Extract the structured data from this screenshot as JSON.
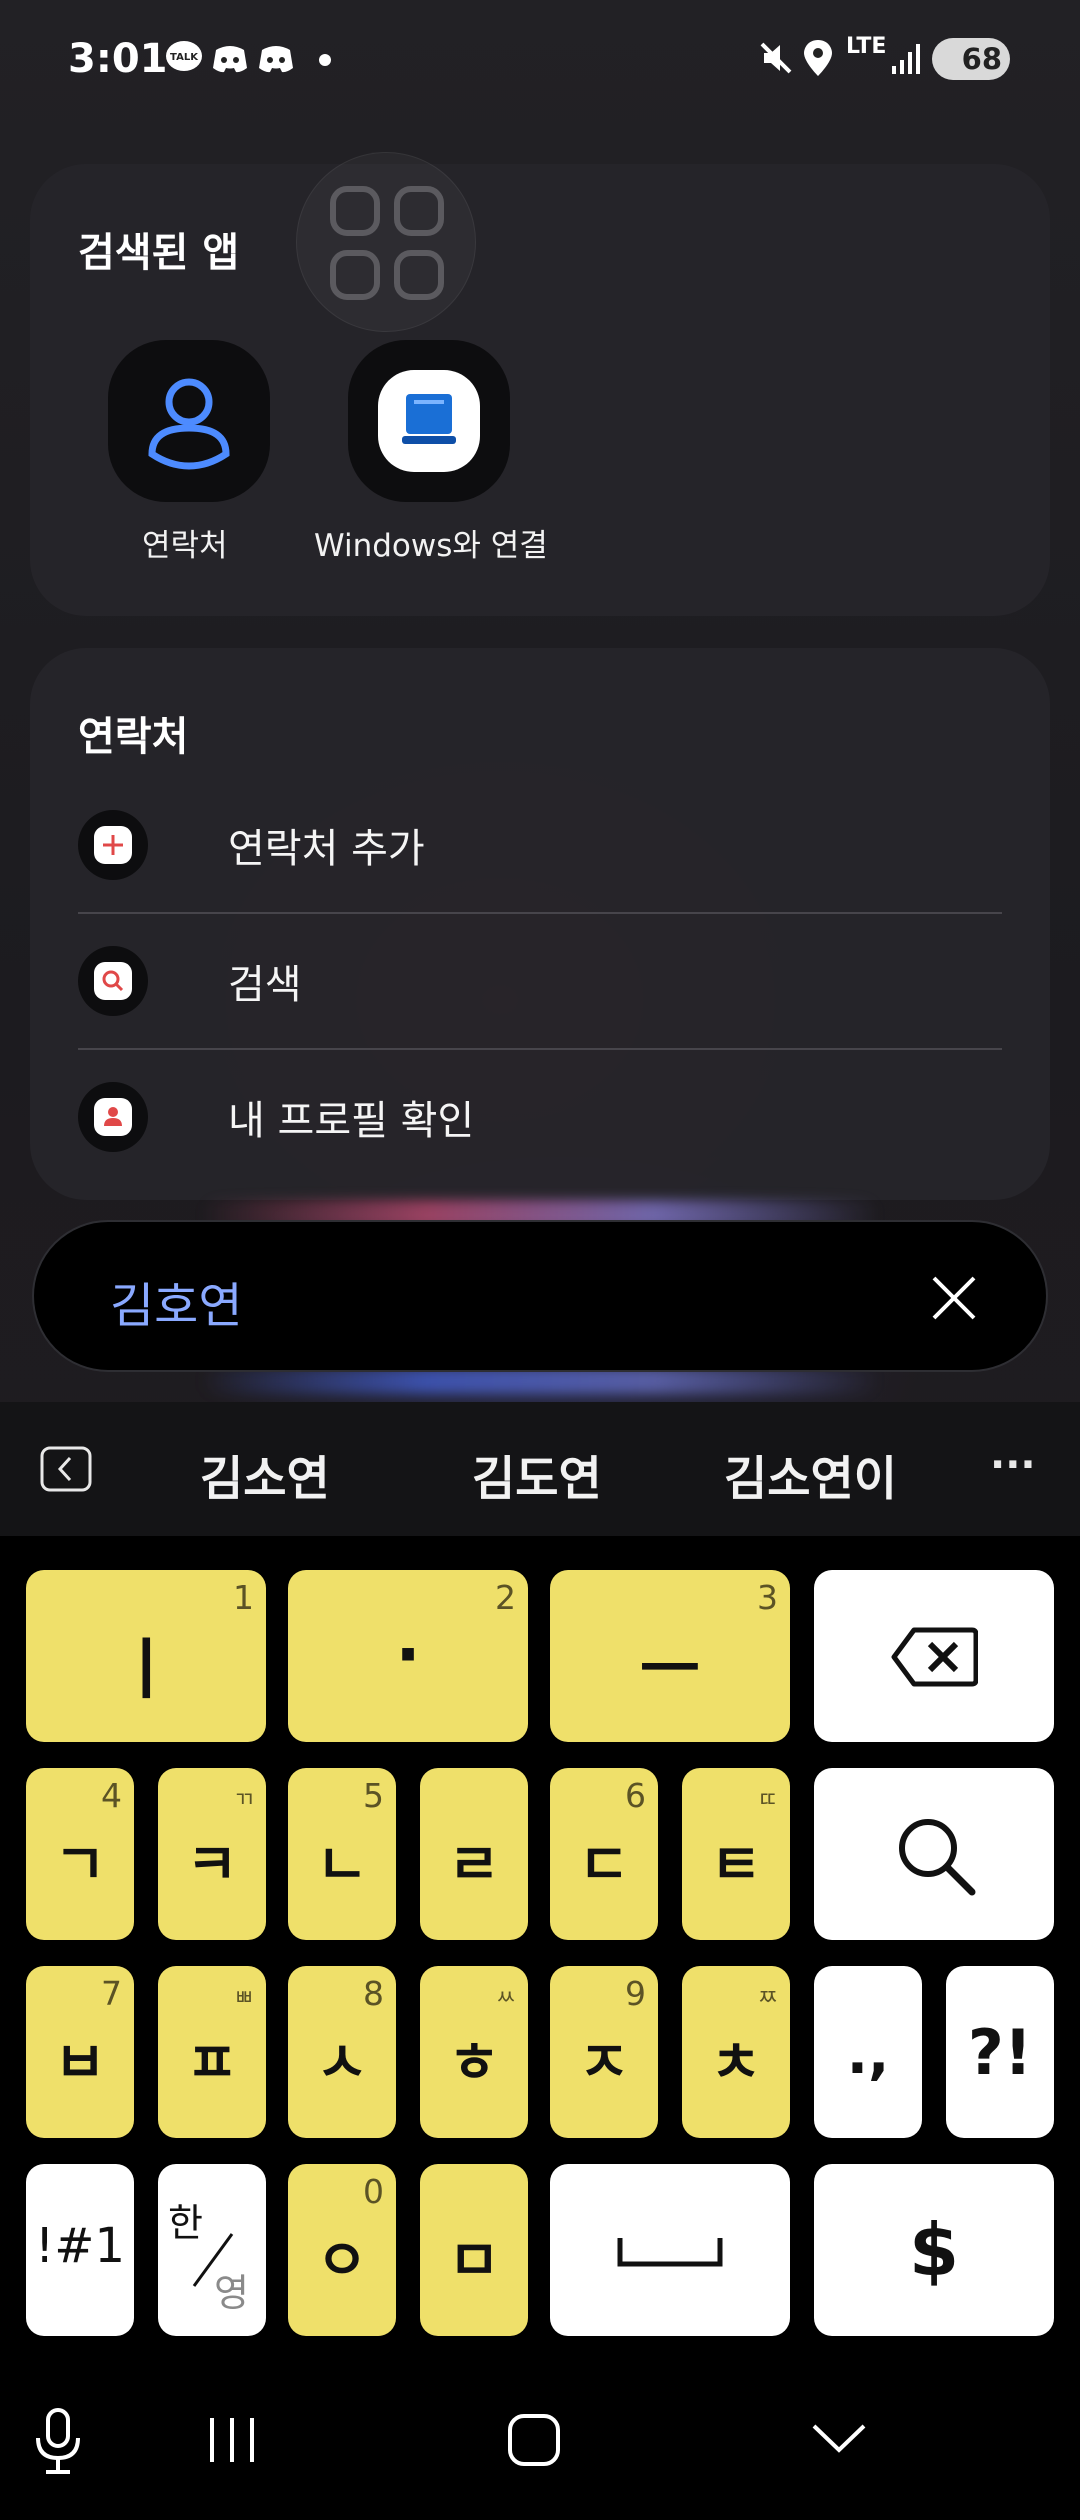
{
  "status_bar": {
    "time": "3:01",
    "talk_badge": "TALK",
    "network": "LTE",
    "battery": "68"
  },
  "apps_card": {
    "title": "검색된 앱",
    "apps": [
      {
        "label": "연락처",
        "icon": "contacts-icon"
      },
      {
        "label": "Windows와 연결",
        "icon": "link-to-windows-icon"
      }
    ]
  },
  "contacts_card": {
    "title": "연락처",
    "actions": [
      {
        "label": "연락처 추가",
        "icon": "add-icon"
      },
      {
        "label": "검색",
        "icon": "search-icon"
      },
      {
        "label": "내 프로필 확인",
        "icon": "profile-icon"
      }
    ]
  },
  "search": {
    "query": "김호연",
    "query_color": "#8aa9ff"
  },
  "suggestions": {
    "words": [
      "김소연",
      "김도연",
      "김소연이"
    ],
    "more": "···"
  },
  "keyboard": {
    "key_color": "#efe06a",
    "row1": [
      {
        "main": "ㅣ",
        "sub": "1"
      },
      {
        "main": "·",
        "sub": "2"
      },
      {
        "main": "ㅡ",
        "sub": "3"
      }
    ],
    "row2": [
      {
        "main": "ㄱ",
        "sub": "4"
      },
      {
        "main": "ㅋ",
        "sub": "ㄲ"
      },
      {
        "main": "ㄴ",
        "sub": "5"
      },
      {
        "main": "ㄹ",
        "sub": ""
      },
      {
        "main": "ㄷ",
        "sub": "6"
      },
      {
        "main": "ㅌ",
        "sub": "ㄸ"
      }
    ],
    "row3": [
      {
        "main": "ㅂ",
        "sub": "7"
      },
      {
        "main": "ㅍ",
        "sub": "ㅃ"
      },
      {
        "main": "ㅅ",
        "sub": "8"
      },
      {
        "main": "ㅎ",
        "sub": "ㅆ"
      },
      {
        "main": "ㅈ",
        "sub": "9"
      },
      {
        "main": "ㅊ",
        "sub": "ㅉ"
      }
    ],
    "punct_key": ".,",
    "question_key": "?!",
    "symbols_key": "!#1",
    "lang_key_top": "한",
    "lang_key_bottom": "영",
    "row4": [
      {
        "main": "ㅇ",
        "sub": "0"
      },
      {
        "main": "ㅁ",
        "sub": ""
      }
    ],
    "currency_key": "$"
  }
}
